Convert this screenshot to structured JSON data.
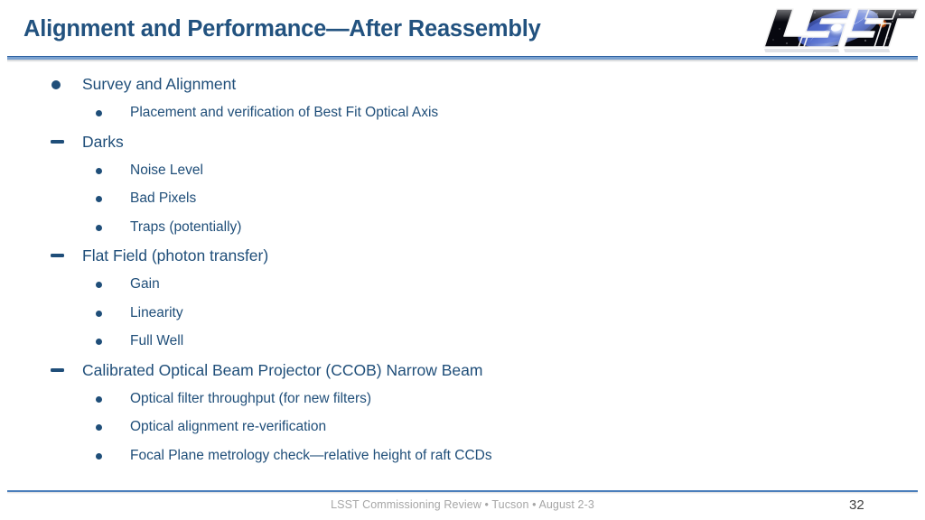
{
  "slide": {
    "title": "Alignment and Performance—After Reassembly",
    "accent_color": "#1F4E79",
    "rule_color": "#4A7EBB",
    "footer_text_color": "#A6A6A6"
  },
  "logo": {
    "name": "lsst-logo",
    "alt_text": "LSST"
  },
  "content": {
    "items": [
      {
        "level": 1,
        "marker": "dot",
        "text": "Survey and Alignment"
      },
      {
        "level": 2,
        "marker": "dot",
        "text": "Placement and verification of Best Fit Optical Axis"
      },
      {
        "level": 1,
        "marker": "dash",
        "text": "Darks"
      },
      {
        "level": 2,
        "marker": "dot",
        "text": "Noise Level"
      },
      {
        "level": 2,
        "marker": "dot",
        "text": "Bad Pixels"
      },
      {
        "level": 2,
        "marker": "dot",
        "text": "Traps (potentially)"
      },
      {
        "level": 1,
        "marker": "dash",
        "text": "Flat Field (photon transfer)"
      },
      {
        "level": 2,
        "marker": "dot",
        "text": "Gain"
      },
      {
        "level": 2,
        "marker": "dot",
        "text": "Linearity"
      },
      {
        "level": 2,
        "marker": "dot",
        "text": "Full Well"
      },
      {
        "level": 1,
        "marker": "dash",
        "text": "Calibrated Optical Beam Projector (CCOB) Narrow Beam"
      },
      {
        "level": 2,
        "marker": "dot",
        "text": "Optical filter throughput (for new filters)"
      },
      {
        "level": 2,
        "marker": "dot",
        "text": "Optical alignment re-verification"
      },
      {
        "level": 2,
        "marker": "dot",
        "text": "Focal Plane metrology check—relative height of raft CCDs"
      }
    ]
  },
  "footer": {
    "text": "LSST Commissioning Review • Tucson  • August 2-3",
    "slide_number": "32"
  }
}
